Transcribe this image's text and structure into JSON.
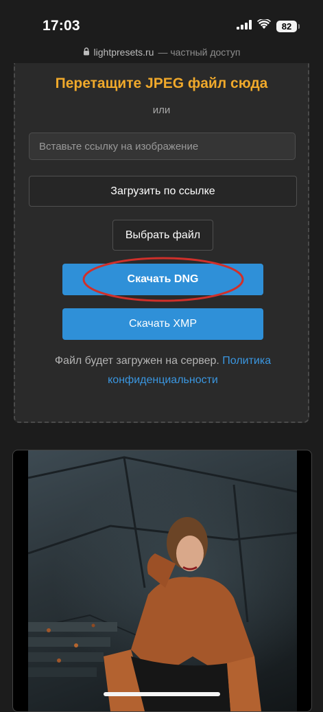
{
  "status": {
    "time": "17:03",
    "battery": "82"
  },
  "browser": {
    "domain": "lightpresets.ru",
    "subtitle": "— частный доступ"
  },
  "upload": {
    "drop_title": "Перетащите JPEG файл сюда",
    "or_text": "или",
    "url_placeholder": "Вставьте ссылку на изображение",
    "load_button": "Загрузить по ссылке",
    "choose_file_button": "Выбрать файл",
    "download_dng_button": "Скачать DNG",
    "download_xmp_button": "Скачать XMP",
    "note_text": "Файл будет загружен на сервер. ",
    "privacy_link": "Политика конфиденциальности"
  },
  "colors": {
    "accent_orange": "#f0a92b",
    "button_blue": "#2f90d8",
    "link_blue": "#3a96e0",
    "highlight_red": "#d0302a"
  }
}
